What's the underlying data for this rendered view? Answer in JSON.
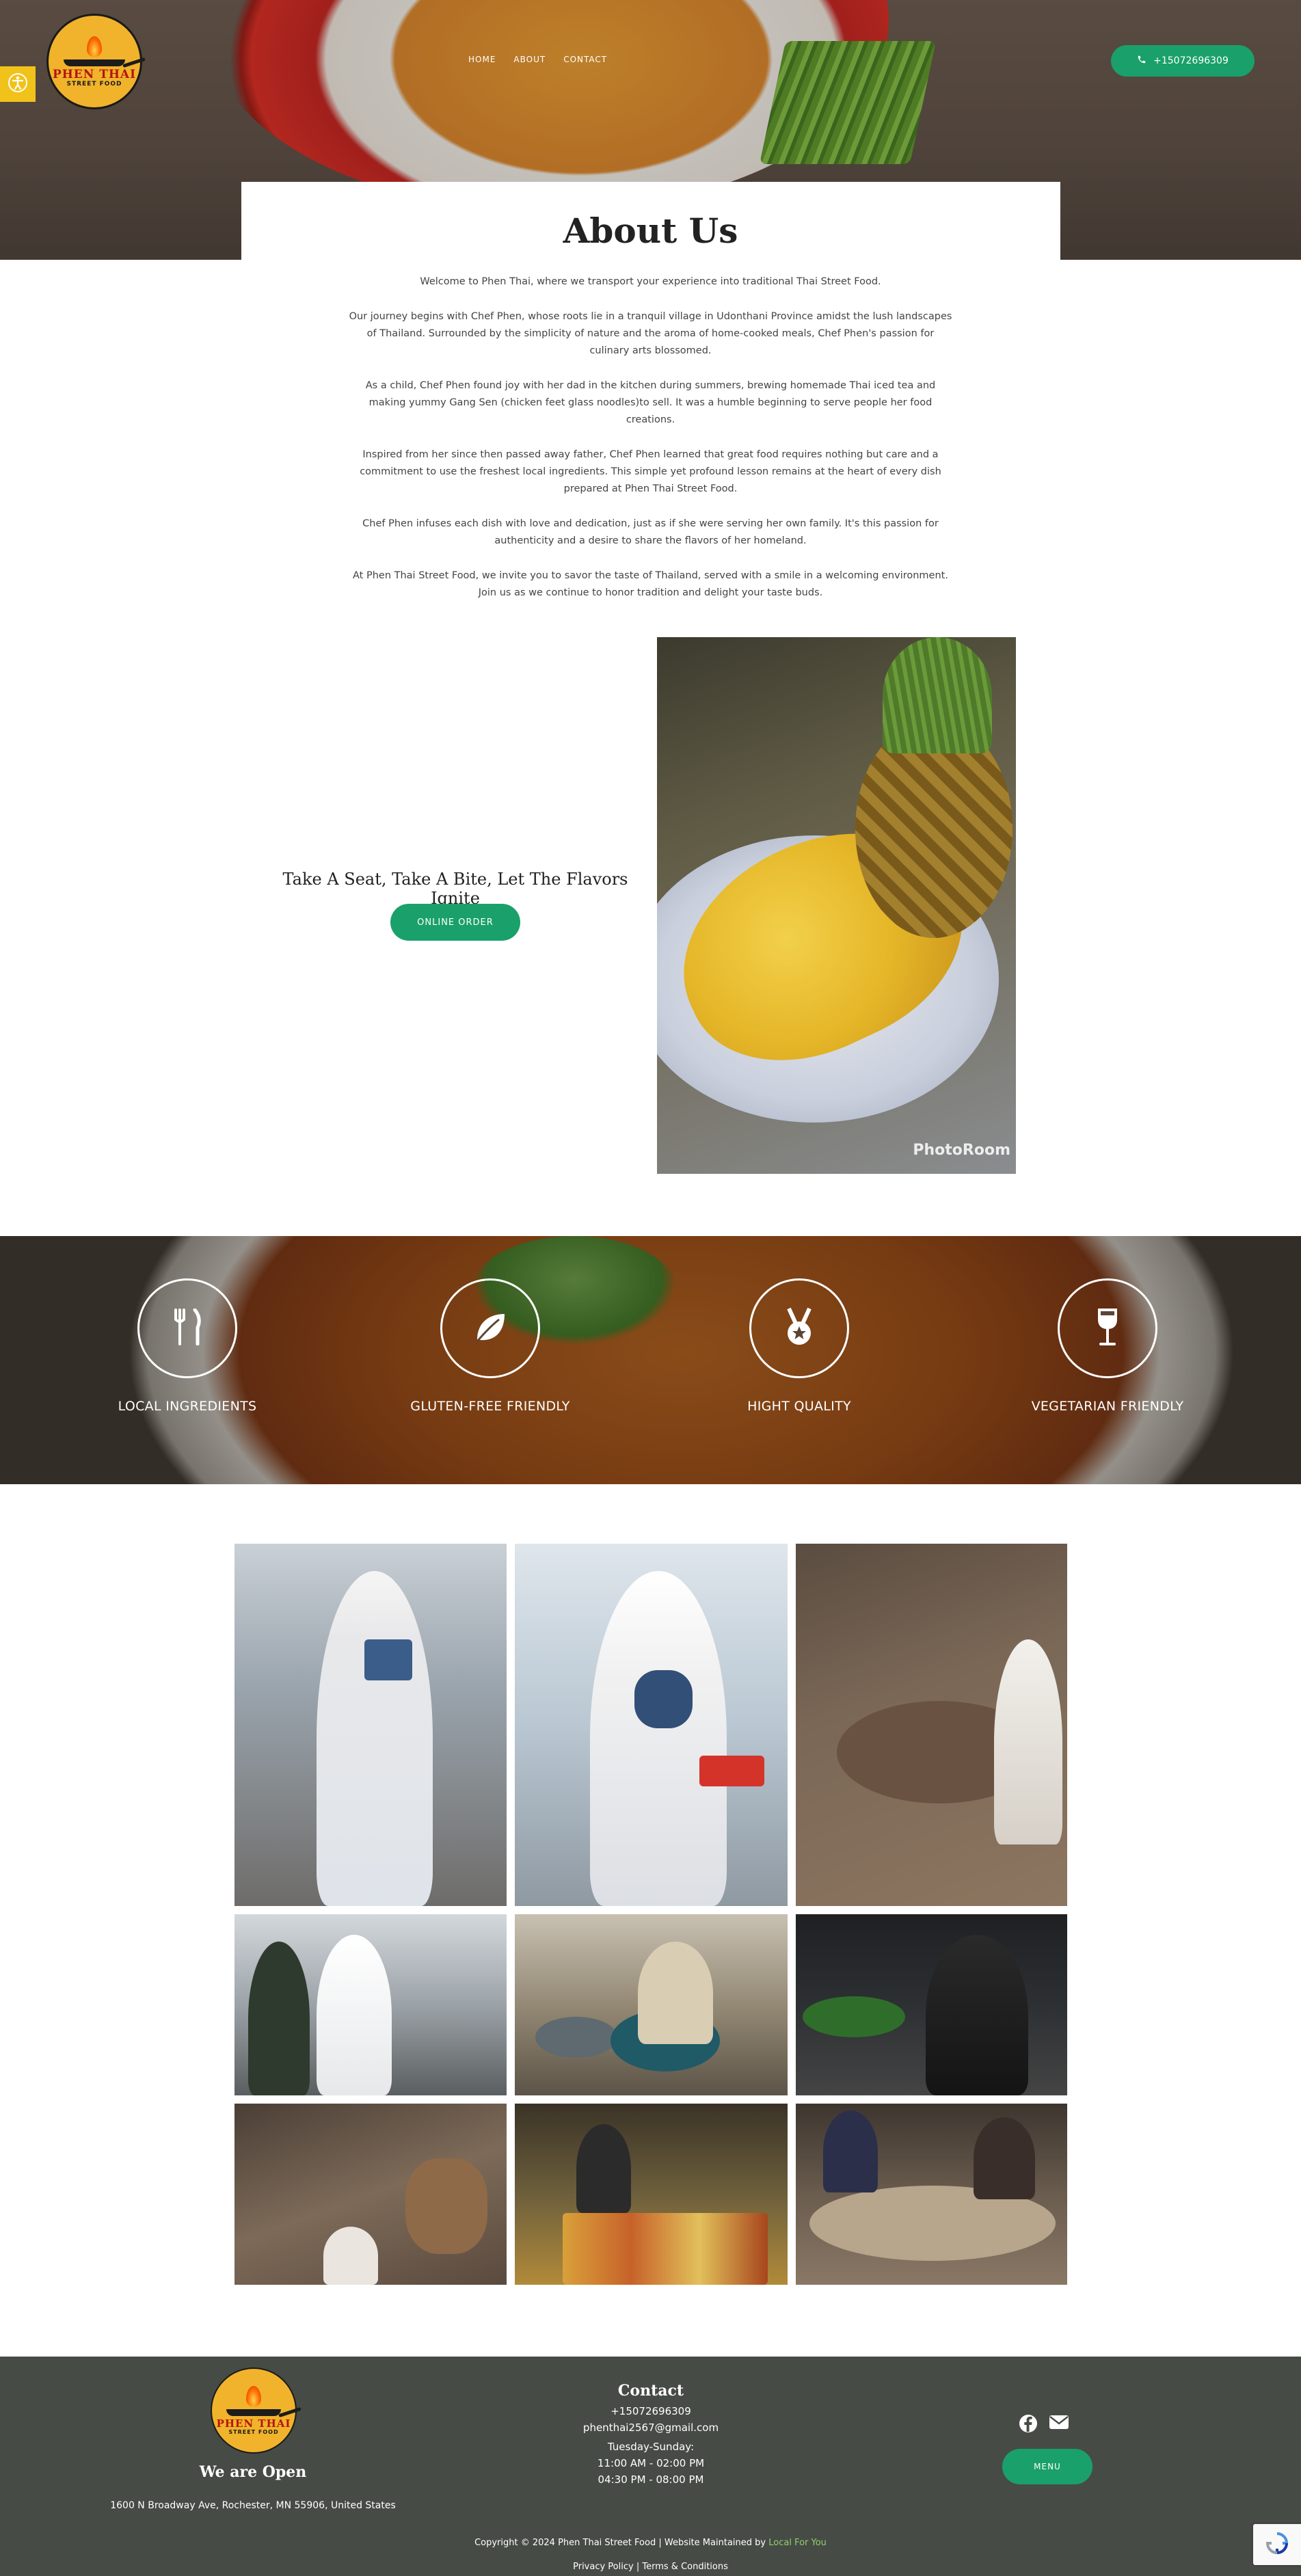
{
  "brand": {
    "logo_name": "PHEN THAI",
    "logo_sub": "STREET FOOD"
  },
  "nav": {
    "items": [
      "HOME",
      "ABOUT",
      "CONTACT"
    ]
  },
  "header": {
    "phone": "+15072696309"
  },
  "icons": {
    "accessibility": "accessibility-icon",
    "phone": "phone-icon",
    "benefit_1": "fork-knife-icon",
    "benefit_2": "leaf-icon",
    "benefit_3": "medal-icon",
    "benefit_4": "wine-glass-icon",
    "facebook": "facebook-icon",
    "email": "envelope-icon"
  },
  "colors": {
    "accent": "#1aa06a",
    "footer_bg": "#474b46",
    "access_btn": "#f1c21a",
    "link": "#8fd06b"
  },
  "about": {
    "title": "About Us",
    "paragraphs": [
      "Welcome to Phen Thai, where we transport your experience into traditional Thai Street Food.",
      "Our journey begins with Chef Phen, whose roots lie in a tranquil village in Udonthani Province amidst the lush landscapes of Thailand. Surrounded by the simplicity of nature and the aroma of home-cooked meals, Chef Phen's passion for culinary arts blossomed.",
      "As a child, Chef Phen found joy with her dad in the kitchen during summers, brewing homemade Thai iced tea and making yummy Gang Sen (chicken feet glass noodles)to sell. It was a humble beginning to serve people her food creations.",
      "Inspired from her since then passed away father, Chef Phen learned that great food requires nothing but care and a commitment to use the freshest local ingredients. This simple yet profound lesson remains at the heart of every dish prepared at Phen Thai Street Food.",
      "Chef Phen infuses each dish with love and dedication, just as if she were serving her own family. It's this passion for authenticity and a desire to share the flavors of her homeland.",
      "At Phen Thai Street Food, we invite you to savor the taste of Thailand, served with a smile in a welcoming environment. Join us as we continue to honor tradition and delight your taste buds."
    ]
  },
  "feature": {
    "tagline": "Take A Seat, Take A Bite, Let The Flavors Ignite",
    "order_button": "ONLINE ORDER",
    "photo_watermark": "PhotoRoom"
  },
  "benefits": [
    {
      "label": "LOCAL INGREDIENTS"
    },
    {
      "label": "GLUTEN-FREE FRIENDLY"
    },
    {
      "label": "HIGHT QUALITY"
    },
    {
      "label": "VEGETARIAN FRIENDLY"
    }
  ],
  "footer": {
    "open_title": "We are Open",
    "address": "1600 N Broadway Ave, Rochester, MN 55906, United States",
    "contact_title": "Contact",
    "phone": "+15072696309",
    "email": "phenthai2567@gmail.com",
    "days": "Tuesday-Sunday:",
    "hours_1": "11:00 AM - 02:00 PM",
    "hours_2": "04:30 PM - 08:00 PM",
    "menu_button": "MENU",
    "copyright": "Copyright © 2024 Phen Thai Street Food | Website Maintained by",
    "maintainer": "Local For You",
    "privacy": "Privacy Policy",
    "separator": "|",
    "terms": "Terms & Conditions"
  }
}
